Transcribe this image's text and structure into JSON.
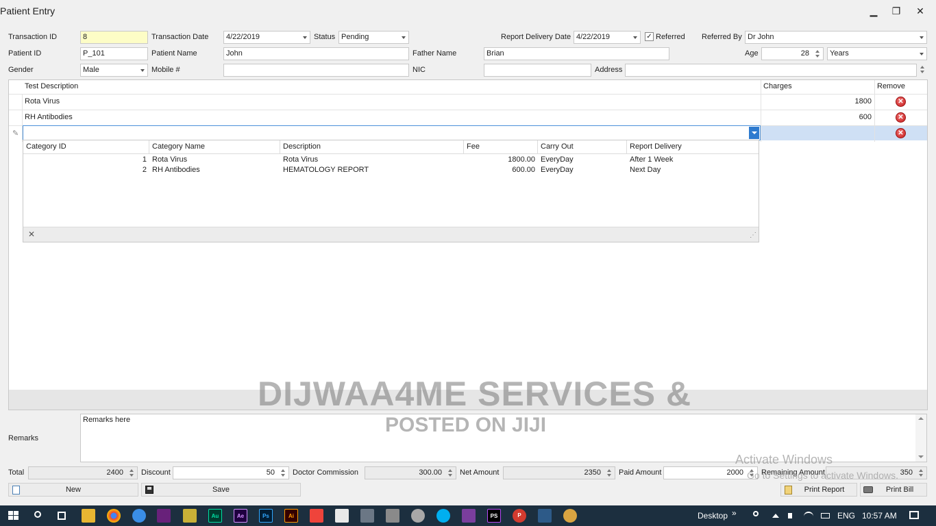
{
  "window": {
    "title": "Patient Entry",
    "minimize": "▁",
    "restore": "❐",
    "close": "✕"
  },
  "form": {
    "transaction_id_label": "Transaction ID",
    "transaction_id": "8",
    "transaction_date_label": "Transaction Date",
    "transaction_date": "4/22/2019",
    "status_label": "Status",
    "status": "Pending",
    "report_delivery_date_label": "Report Delivery Date",
    "report_delivery_date": "4/22/2019",
    "referred_check": "✓",
    "referred_label": "Referred",
    "referred_by_label": "Referred By",
    "referred_by": "Dr John",
    "patient_id_label": "Patient ID",
    "patient_id": "P_101",
    "patient_name_label": "Patient Name",
    "patient_name": "John",
    "father_name_label": "Father Name",
    "father_name": "Brian",
    "age_label": "Age",
    "age": "28",
    "age_unit": "Years",
    "gender_label": "Gender",
    "gender": "Male",
    "mobile_label": "Mobile #",
    "mobile": "",
    "nic_label": "NIC",
    "nic": "",
    "address_label": "Address",
    "address": ""
  },
  "grid": {
    "headers": {
      "test_description": "Test Description",
      "charges": "Charges",
      "remove": "Remove"
    },
    "rows": [
      {
        "test_description": "Rota Virus",
        "charges": "1800"
      },
      {
        "test_description": "RH Antibodies",
        "charges": "600"
      }
    ],
    "edit_row_icon": "✎",
    "remove_glyph": "✕"
  },
  "lookup": {
    "headers": [
      "Category ID",
      "Category Name",
      "Description",
      "Fee",
      "Carry Out",
      "Report Delivery"
    ],
    "rows": [
      {
        "id": "1",
        "name": "Rota Virus",
        "description": "Rota Virus",
        "fee": "1800.00",
        "carry_out": "EveryDay",
        "report_delivery": "After 1 Week"
      },
      {
        "id": "2",
        "name": "RH Antibodies",
        "description": "HEMATOLOGY REPORT",
        "fee": "600.00",
        "carry_out": "EveryDay",
        "report_delivery": "Next Day"
      }
    ],
    "clear_glyph": "✕",
    "resize_glyph": "⋰"
  },
  "remarks": {
    "label": "Remarks",
    "value": "Remarks here"
  },
  "totals": {
    "total_label": "Total",
    "total": "2400",
    "discount_label": "Discount",
    "discount": "50",
    "doctor_commission_label": "Doctor Commission",
    "doctor_commission": "300.00",
    "net_amount_label": "Net Amount",
    "net_amount": "2350",
    "paid_amount_label": "Paid Amount",
    "paid_amount": "2000",
    "remaining_amount_label": "Remaining Amount",
    "remaining_amount": "350"
  },
  "buttons": {
    "new": "New",
    "save": "Save",
    "print_report": "Print Report",
    "print_bill": "Print Bill"
  },
  "watermark": {
    "line1": "DIJWAA4ME SERVICES &",
    "line2": "POSTED ON JIJI"
  },
  "activation": {
    "line1": "Activate Windows",
    "line2": "Go to Settings to activate Windows."
  },
  "taskbar": {
    "desktop_label": "Desktop",
    "chevron": "»",
    "language": "ENG",
    "time": "10:57 AM",
    "icons": [
      "start-icon",
      "search-icon",
      "task-view-icon",
      "file-explorer-icon",
      "chrome-icon",
      "edge-icon",
      "visual-studio-icon",
      "notepad-icon",
      "audition-icon",
      "after-effects-icon",
      "photoshop-icon",
      "illustrator-icon",
      "anydesk-icon",
      "office-icon",
      "tools-icon",
      "database-icon",
      "sql-icon",
      "skype-icon",
      "winrar-icon",
      "phpstorm-icon",
      "pdf-icon",
      "app-icon",
      "paint-icon"
    ],
    "labels": {
      "ae": "Ae",
      "ps": "Ps",
      "ai": "Ai",
      "au": "Au",
      "phps": "PS",
      "pdf": "P"
    }
  }
}
